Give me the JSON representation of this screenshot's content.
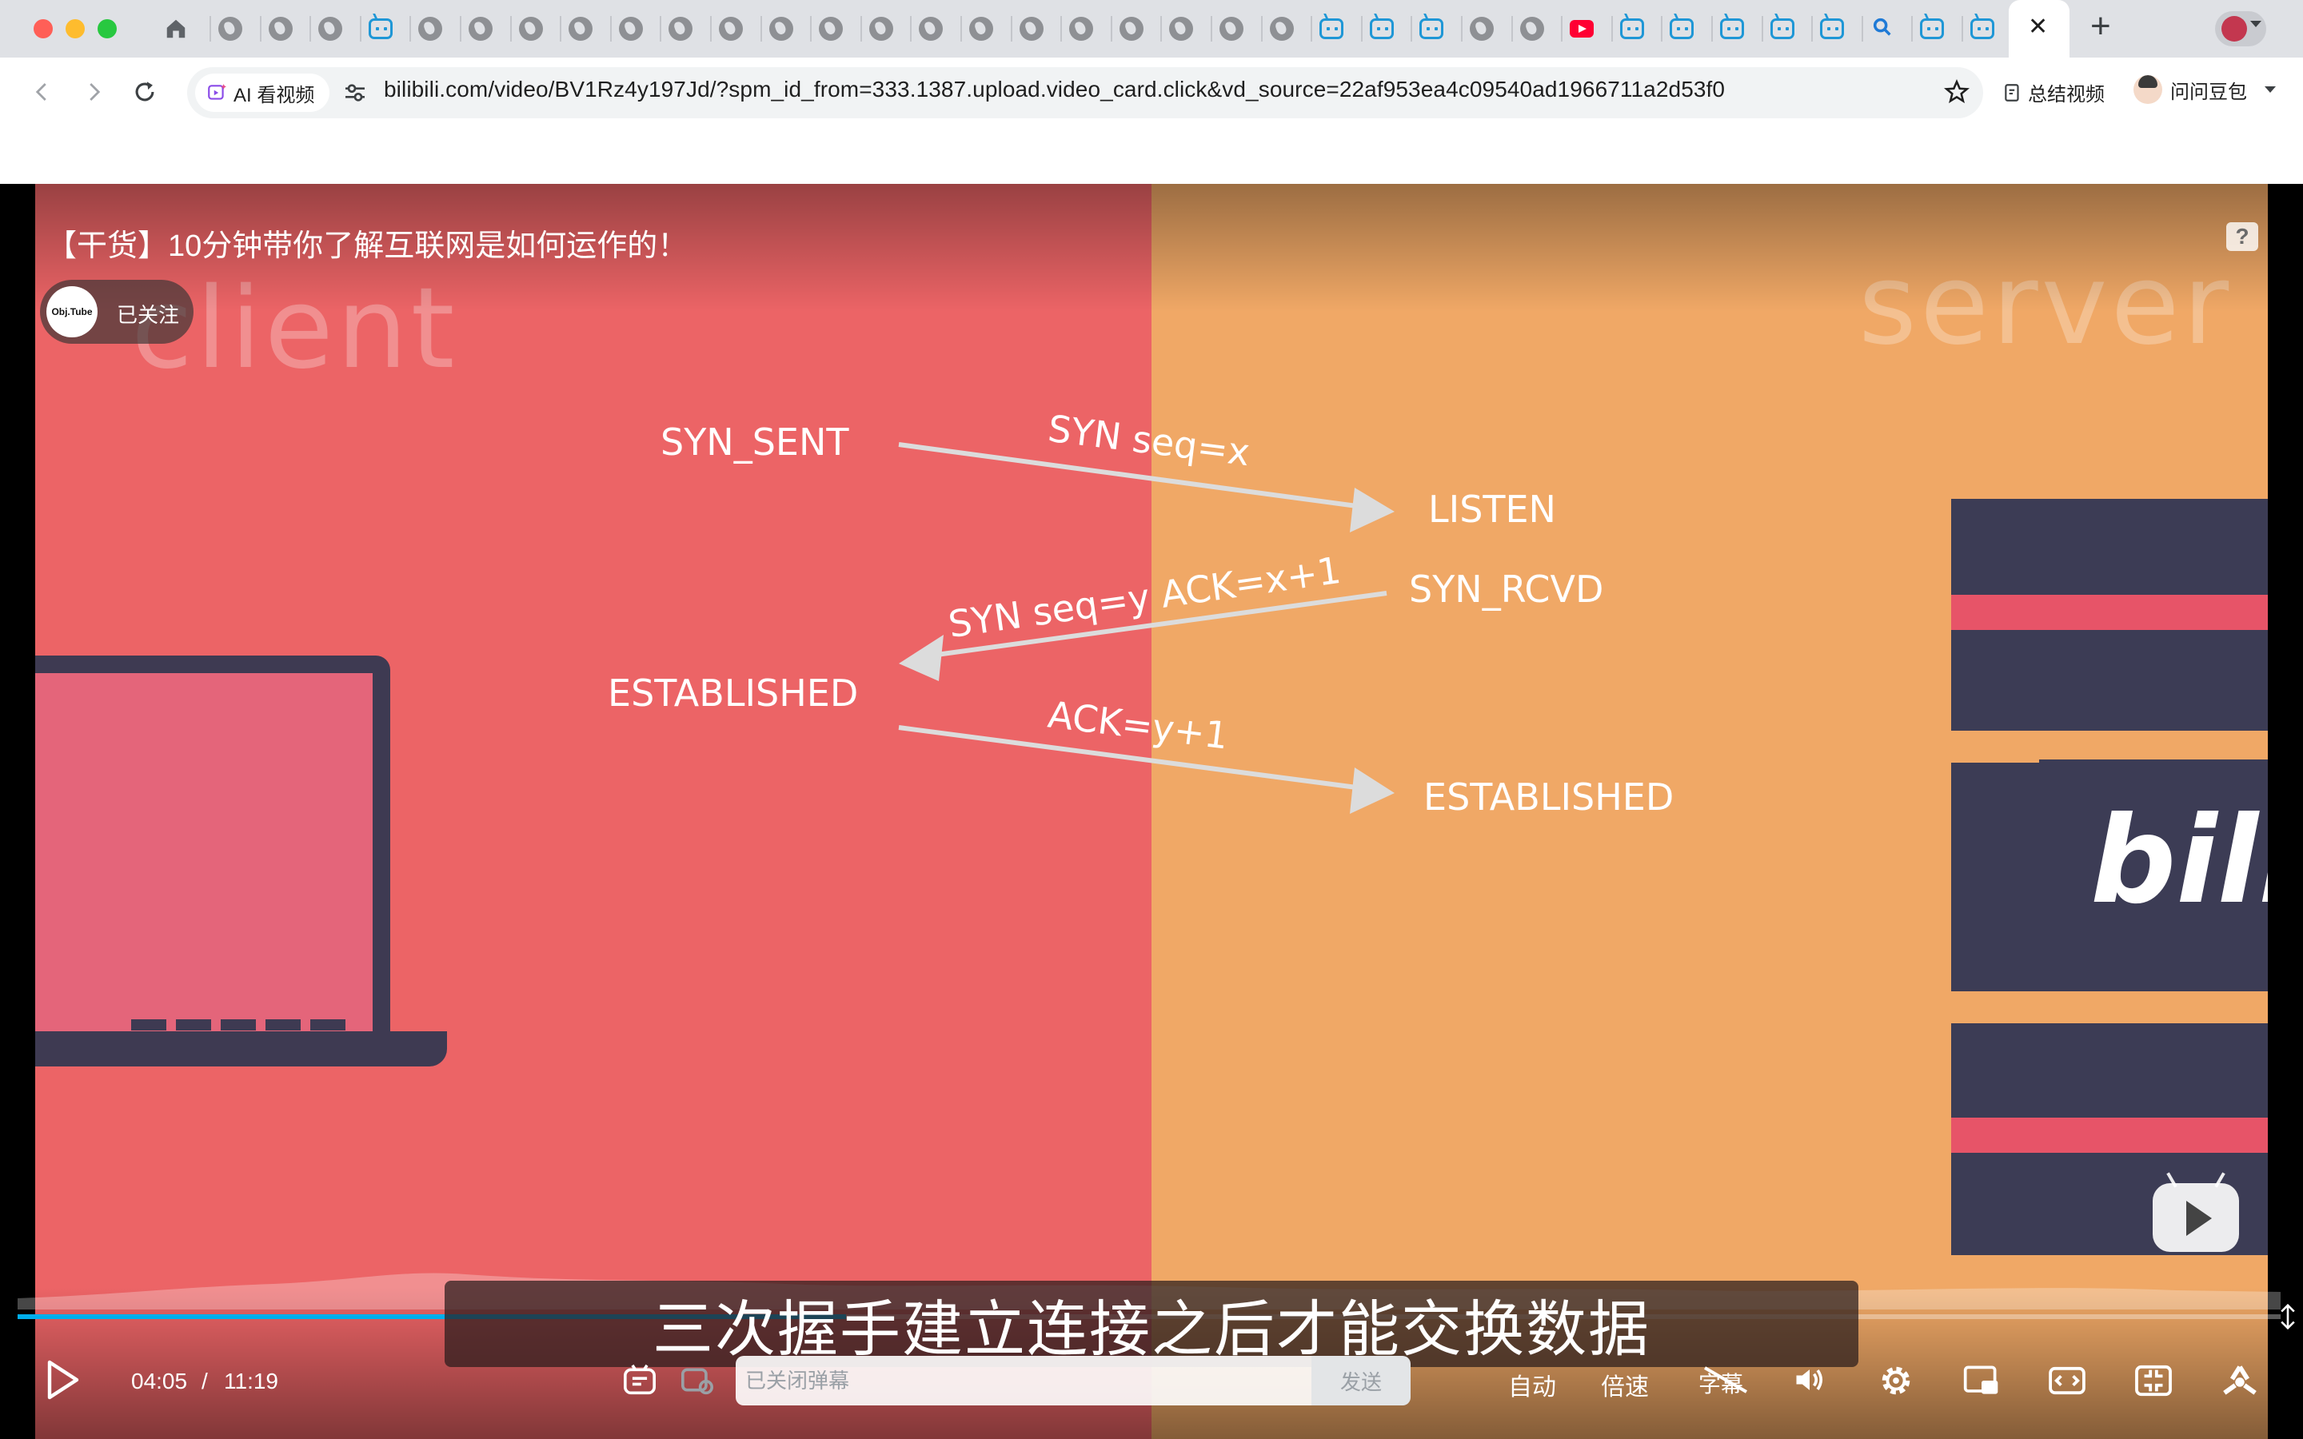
{
  "browser": {
    "tabs": {
      "active_close_symbol": "✕",
      "new_tab_symbol": "+"
    },
    "toolbar": {
      "ai_chip_label": "AI 看视频",
      "url": "bilibili.com/video/BV1Rz4y197Jd/?spm_id_from=333.1387.upload.video_card.click&vd_source=22af953ea4c09540ad1966711a2d53f0",
      "summarize_label": "总结视频",
      "assistant_label": "问问豆包"
    }
  },
  "player": {
    "video_title": "【干货】10分钟带你了解互联网是如何运作的！",
    "uploader": {
      "avatar_text": "Obj.Tube",
      "follow_status": "已关注"
    },
    "help_label": "?",
    "scene": {
      "client_label": "client",
      "server_label": "server",
      "states": {
        "syn_sent": "SYN_SENT",
        "listen": "LISTEN",
        "syn_rcvd": "SYN_RCVD",
        "established_client": "ESTABLISHED",
        "established_server": "ESTABLISHED"
      },
      "messages": {
        "syn": "SYN seq=x",
        "syn_ack": "SYN seq=y ACK=x+1",
        "ack": "ACK=y+1"
      },
      "logo_text": "bili"
    },
    "subtitle": "三次握手建立连接之后才能交换数据",
    "progress_fraction": 0.366,
    "controls": {
      "current_time": "04:05",
      "time_separator": "/",
      "total_time": "11:19",
      "danmaku_placeholder": "已关闭弹幕",
      "send_label": "发送",
      "quality_label": "自动",
      "speed_label": "倍速",
      "subtitle_toggle_label": "字幕"
    },
    "accent_color": "#00aeec"
  }
}
